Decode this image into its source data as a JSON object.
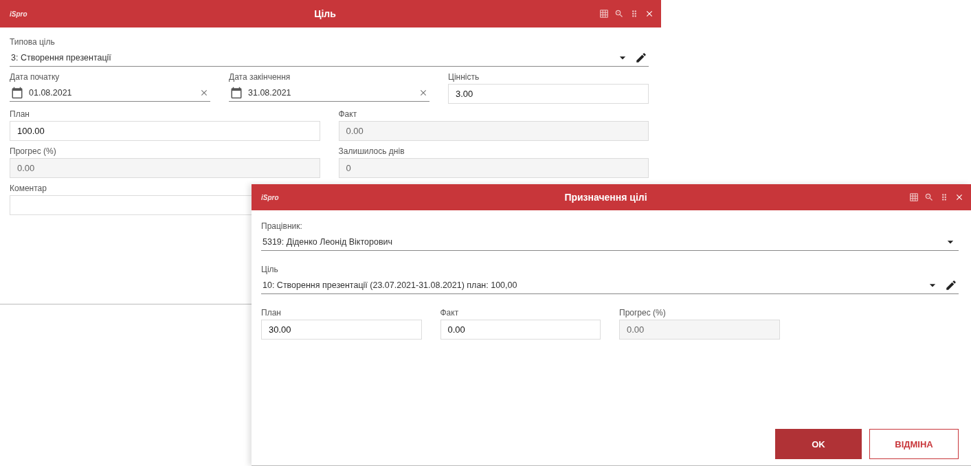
{
  "windows": [
    {
      "logo": "iSpro",
      "title": "Ціль",
      "rows": [
        [
          {
            "kind": "select",
            "label": "Типова ціль",
            "value": "3: Створення презентації",
            "editable": true
          }
        ],
        [
          {
            "kind": "date",
            "label": "Дата початку",
            "value": "01.08.2021"
          },
          {
            "kind": "date",
            "label": "Дата закінчення",
            "value": "31.08.2021"
          },
          {
            "kind": "text",
            "label": "Цінність",
            "value": "3.00",
            "disabled": false
          }
        ],
        [
          {
            "kind": "text",
            "label": "План",
            "value": "100.00",
            "disabled": false
          },
          {
            "kind": "text",
            "label": "Факт",
            "value": "0.00",
            "disabled": true
          }
        ],
        [
          {
            "kind": "text",
            "label": "Прогрес (%)",
            "value": "0.00",
            "disabled": true
          },
          {
            "kind": "text",
            "label": "Залишилось днів",
            "value": "0",
            "disabled": true
          }
        ],
        [
          {
            "kind": "text",
            "label": "Коментар"
          }
        ]
      ]
    },
    {
      "logo": "iSpro",
      "title": "Призначення цілі",
      "rows": [
        [
          {
            "kind": "select",
            "label": "Працівник:",
            "value": "5319: Діденко Леонід Вікторович"
          }
        ],
        [
          {
            "kind": "select",
            "label": "Ціль",
            "value": "10: Створення презентації (23.07.2021-31.08.2021) план: 100,00",
            "editable": true
          }
        ],
        [
          {
            "kind": "text",
            "label": "План",
            "value": "30.00",
            "disabled": false
          },
          {
            "kind": "text",
            "label": "Факт",
            "value": "0.00",
            "disabled": false
          },
          {
            "kind": "text",
            "label": "Прогрес (%)",
            "value": "0.00",
            "disabled": true
          }
        ]
      ],
      "buttons": [
        {
          "label": "OK",
          "primary": true
        },
        {
          "label": "ВІДМІНА",
          "primary": false
        }
      ]
    }
  ]
}
